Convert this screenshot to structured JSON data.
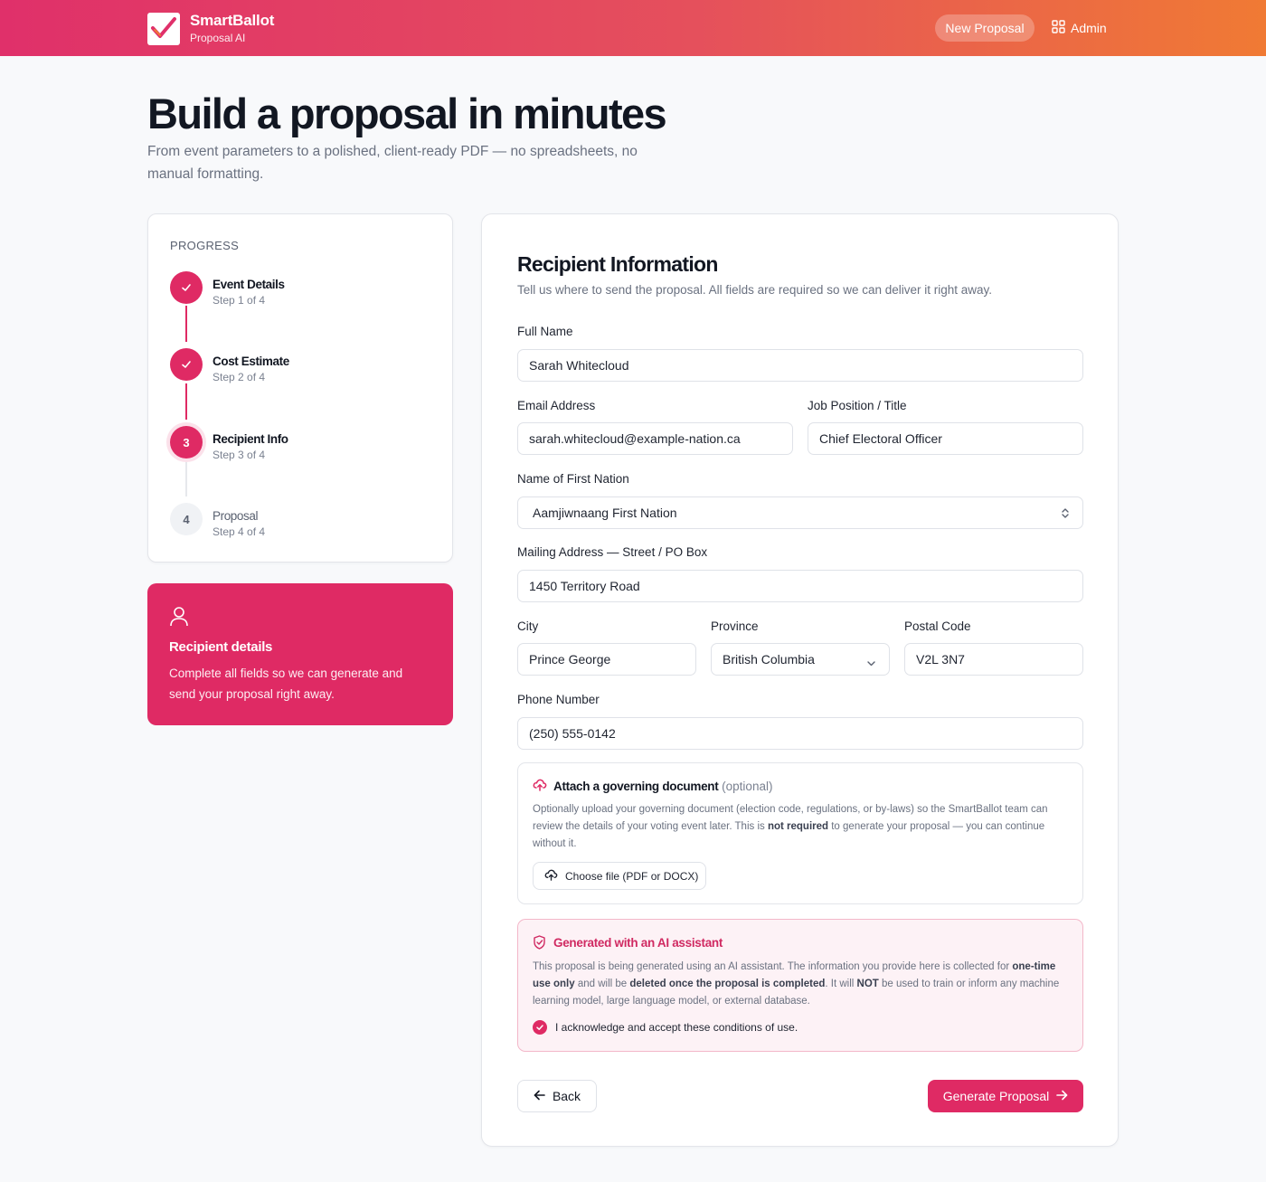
{
  "header": {
    "brand_name": "SmartBallot",
    "brand_sub": "Proposal AI",
    "new_proposal": "New Proposal",
    "admin": "Admin"
  },
  "hero": {
    "title": "Build a proposal in minutes",
    "subtitle": "From event parameters to a polished, client-ready PDF — no spreadsheets, no manual formatting."
  },
  "progress": {
    "label": "PROGRESS",
    "steps": [
      {
        "title": "Event Details",
        "meta": "Step 1 of 4",
        "status": "done"
      },
      {
        "title": "Cost Estimate",
        "meta": "Step 2 of 4",
        "status": "done"
      },
      {
        "title": "Recipient Info",
        "meta": "Step 3 of 4",
        "status": "current",
        "number": "3"
      },
      {
        "title": "Proposal",
        "meta": "Step 4 of 4",
        "status": "todo",
        "number": "4"
      }
    ]
  },
  "info_card": {
    "title": "Recipient details",
    "text": "Complete all fields so we can generate and send your proposal right away."
  },
  "form": {
    "title": "Recipient Information",
    "subtitle": "Tell us where to send the proposal. All fields are required so we can deliver it right away.",
    "full_name": {
      "label": "Full Name",
      "value": "Sarah Whitecloud"
    },
    "email": {
      "label": "Email Address",
      "value": "sarah.whitecloud@example-nation.ca"
    },
    "job": {
      "label": "Job Position / Title",
      "value": "Chief Electoral Officer"
    },
    "nation": {
      "label": "Name of First Nation",
      "value": "Aamjiwnaang First Nation"
    },
    "street": {
      "label": "Mailing Address — Street / PO Box",
      "value": "1450 Territory Road"
    },
    "city": {
      "label": "City",
      "value": "Prince George"
    },
    "province": {
      "label": "Province",
      "value": "British Columbia"
    },
    "postal": {
      "label": "Postal Code",
      "value": "V2L 3N7"
    },
    "phone": {
      "label": "Phone Number",
      "value": "(250) 555-0142"
    }
  },
  "attach": {
    "title": "Attach a governing document",
    "optional": " (optional)",
    "desc_1": "Optionally upload your governing document (election code, regulations, or by-laws) so the SmartBallot team can review the details of your voting event later. This is ",
    "desc_bold": "not required",
    "desc_2": " to generate your proposal — you can continue without it.",
    "button": "Choose file (PDF or DOCX)"
  },
  "ai": {
    "title": "Generated with an AI assistant",
    "d1": "This proposal is being generated using an AI assistant. The information you provide here is collected for ",
    "b1": "one-time use only",
    "d2": " and will be ",
    "b2": "deleted once the proposal is completed",
    "d3": ". It will ",
    "b3": "NOT",
    "d4": " be used to train or inform any machine learning model, large language model, or external database.",
    "ack": "I acknowledge and accept these conditions of use."
  },
  "actions": {
    "back": "Back",
    "generate": "Generate Proposal"
  },
  "colors": {
    "accent": "#df2a64",
    "gradient_start": "#e0306a",
    "gradient_end": "#f07a34"
  }
}
